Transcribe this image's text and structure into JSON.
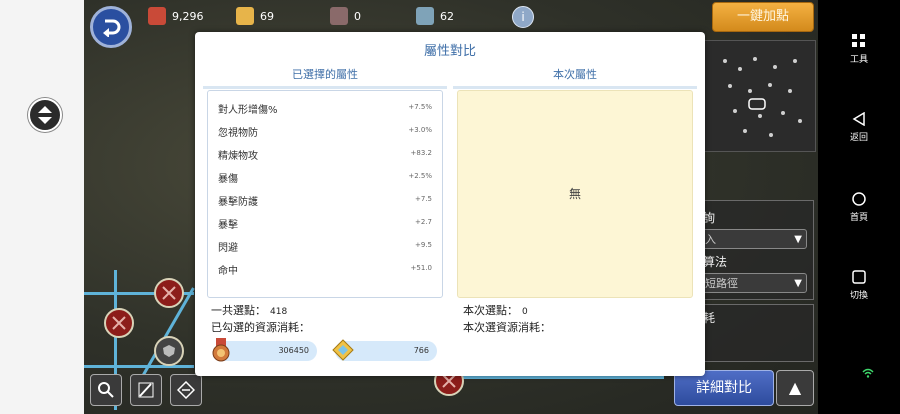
{
  "resources": [
    {
      "icon": "medal-icon",
      "value": "9,296"
    },
    {
      "icon": "gem-pile-icon",
      "value": "69"
    },
    {
      "icon": "bag-icon",
      "value": "0"
    },
    {
      "icon": "crate-icon",
      "value": "62"
    }
  ],
  "top": {
    "auto_button": "一鍵加點"
  },
  "dialog": {
    "title": "屬性對比",
    "left_header": "已選擇的屬性",
    "right_header": "本次屬性",
    "selected_attrs": [
      {
        "name": "對人形增傷%",
        "value": "+7.5%"
      },
      {
        "name": "忽視物防",
        "value": "+3.0%"
      },
      {
        "name": "精煉物攻",
        "value": "+83.2"
      },
      {
        "name": "暴傷",
        "value": "+2.5%"
      },
      {
        "name": "暴擊防護",
        "value": "+7.5"
      },
      {
        "name": "暴擊",
        "value": "+2.7"
      },
      {
        "name": "閃避",
        "value": "+9.5"
      },
      {
        "name": "命中",
        "value": "+51.0"
      }
    ],
    "current_empty": "無",
    "total_points_label": "一共選點：",
    "total_points": "418",
    "selected_cost_label": "已勾選的資源消耗：",
    "cost_medal": "306450",
    "cost_gem": "766",
    "current_points_label": "本次選點：",
    "current_points": "0",
    "current_cost_label": "本次選資源消耗："
  },
  "side": {
    "query_label": "查詢",
    "query_placeholder": "輸入",
    "algo_label": "演算法",
    "algo_value": "最短路徑",
    "cost_label": "消耗"
  },
  "bottom": {
    "detail_button": "詳細對比",
    "up_icon": "▲"
  },
  "phone_nav": {
    "tools": "工具",
    "back": "返回",
    "home": "首頁",
    "switch": "切換"
  },
  "colors": {
    "accent": "#3f6fa8",
    "highlight": "#fdf6d5",
    "button": "#2e4c9d",
    "orange": "#d38a1c"
  }
}
